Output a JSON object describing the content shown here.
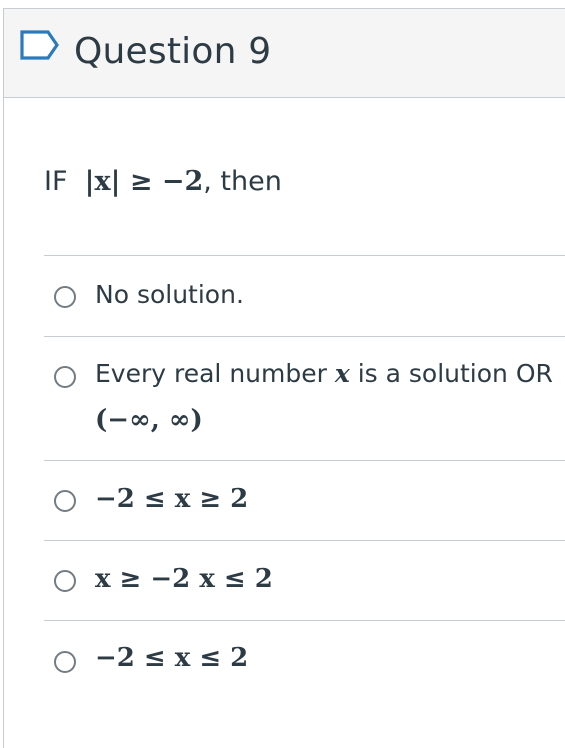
{
  "header": {
    "title": "Question 9",
    "icon": "flag-icon"
  },
  "question": {
    "prefix": "IF",
    "expression": "|x| ≥ −2",
    "suffix": ", then"
  },
  "options": [
    {
      "text": "No solution."
    },
    {
      "text_a": "Every real number",
      "var": "x",
      "text_b": "is a solution OR",
      "line2": "(−∞, ∞)"
    },
    {
      "math": "−2 ≤ x ≥ 2"
    },
    {
      "math": "x ≥ −2 x ≤ 2"
    },
    {
      "math": "−2 ≤ x ≤ 2"
    }
  ],
  "colors": {
    "header_bg": "#f5f5f5",
    "border": "#c7cdd1",
    "text": "#2d3b45",
    "flag": "#2b7abc"
  }
}
